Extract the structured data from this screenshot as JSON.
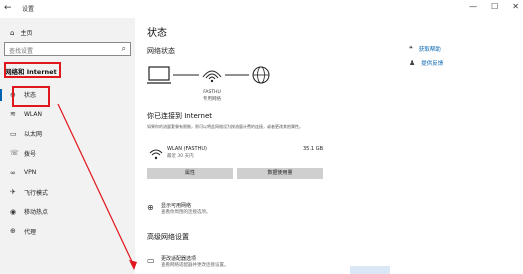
{
  "window": {
    "back_glyph": "←",
    "title": "设置",
    "controls": [
      "—",
      "☐",
      "✕"
    ]
  },
  "sidebar": {
    "home_label": "主页",
    "search_placeholder": "查找设置",
    "section_title": "网络和 Internet",
    "items": [
      {
        "icon": "globe-icon",
        "glyph": "⊕",
        "label": "状态"
      },
      {
        "icon": "wifi-icon",
        "glyph": "≋",
        "label": "WLAN"
      },
      {
        "icon": "ethernet-icon",
        "glyph": "▭",
        "label": "以太网"
      },
      {
        "icon": "dialup-icon",
        "glyph": "☏",
        "label": "拨号"
      },
      {
        "icon": "vpn-icon",
        "glyph": "∞",
        "label": "VPN"
      },
      {
        "icon": "airplane-icon",
        "glyph": "✈",
        "label": "飞行模式"
      },
      {
        "icon": "hotspot-icon",
        "glyph": "◉",
        "label": "移动热点"
      },
      {
        "icon": "proxy-icon",
        "glyph": "⊕",
        "label": "代理"
      }
    ]
  },
  "main": {
    "title": "状态",
    "network_status_heading": "网络状态",
    "network_name": "FASTHU",
    "network_type": "专用网络",
    "connected_heading": "你已连接到 Internet",
    "connected_desc": "如果你的流量套餐有限制，则可以将此网络设为按流量计费的连接，或者更改其他属性。",
    "wlan_name": "WLAN (FASTHU)",
    "wlan_sub": "最近 30 天内",
    "wlan_size": "35.1 GB",
    "btn_properties": "属性",
    "btn_data_usage": "数据使用量",
    "available_networks_title": "显示可用网络",
    "available_networks_sub": "查看你周围的连接选项。",
    "advanced_heading": "高级网络设置",
    "adapter_options_title": "更改适配器选项",
    "adapter_options_sub": "查看网络适配器并更改连接设置。"
  },
  "right_links": {
    "help": "获取帮助",
    "feedback": "提供反馈"
  },
  "colors": {
    "accent": "#0063b1",
    "annotation_red": "#e0171d",
    "sidebar_bg": "#f2f2f2",
    "button_bg": "#cfcfcf"
  }
}
